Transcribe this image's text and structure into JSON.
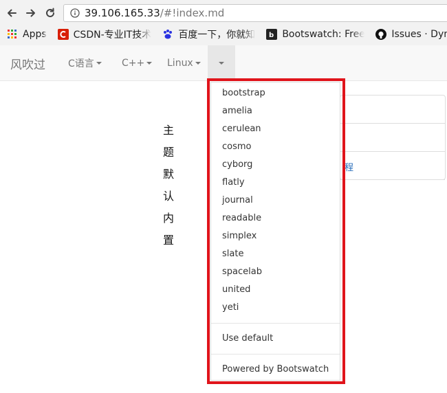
{
  "browser": {
    "url_host": "39.106.165.33",
    "url_path": "/#!index.md",
    "bookmarks": [
      {
        "icon": "apps-grid-icon",
        "label": "Apps"
      },
      {
        "icon": "csdn-logo-icon",
        "label": "CSDN-专业IT技术"
      },
      {
        "icon": "baidu-paw-icon",
        "label": "百度一下，你就知"
      },
      {
        "icon": "bootswatch-logo-icon",
        "label": "Bootswatch: Free"
      },
      {
        "icon": "github-logo-icon",
        "label": "Issues · Dynalon"
      }
    ]
  },
  "navbar": {
    "brand": "风吹过",
    "items": [
      {
        "label": "C语言"
      },
      {
        "label": "C++"
      },
      {
        "label": "Linux"
      }
    ]
  },
  "content": {
    "vertical_text": [
      "主",
      "题",
      "默",
      "认",
      "内",
      "置"
    ],
    "panel_link": "程"
  },
  "dropdown": {
    "themes": [
      "bootstrap",
      "amelia",
      "cerulean",
      "cosmo",
      "cyborg",
      "flatly",
      "journal",
      "readable",
      "simplex",
      "slate",
      "spacelab",
      "united",
      "yeti"
    ],
    "use_default": "Use default",
    "powered_by": "Powered by Bootswatch"
  },
  "colors": {
    "highlight": "#e0141b",
    "link": "#2a6ebb"
  }
}
